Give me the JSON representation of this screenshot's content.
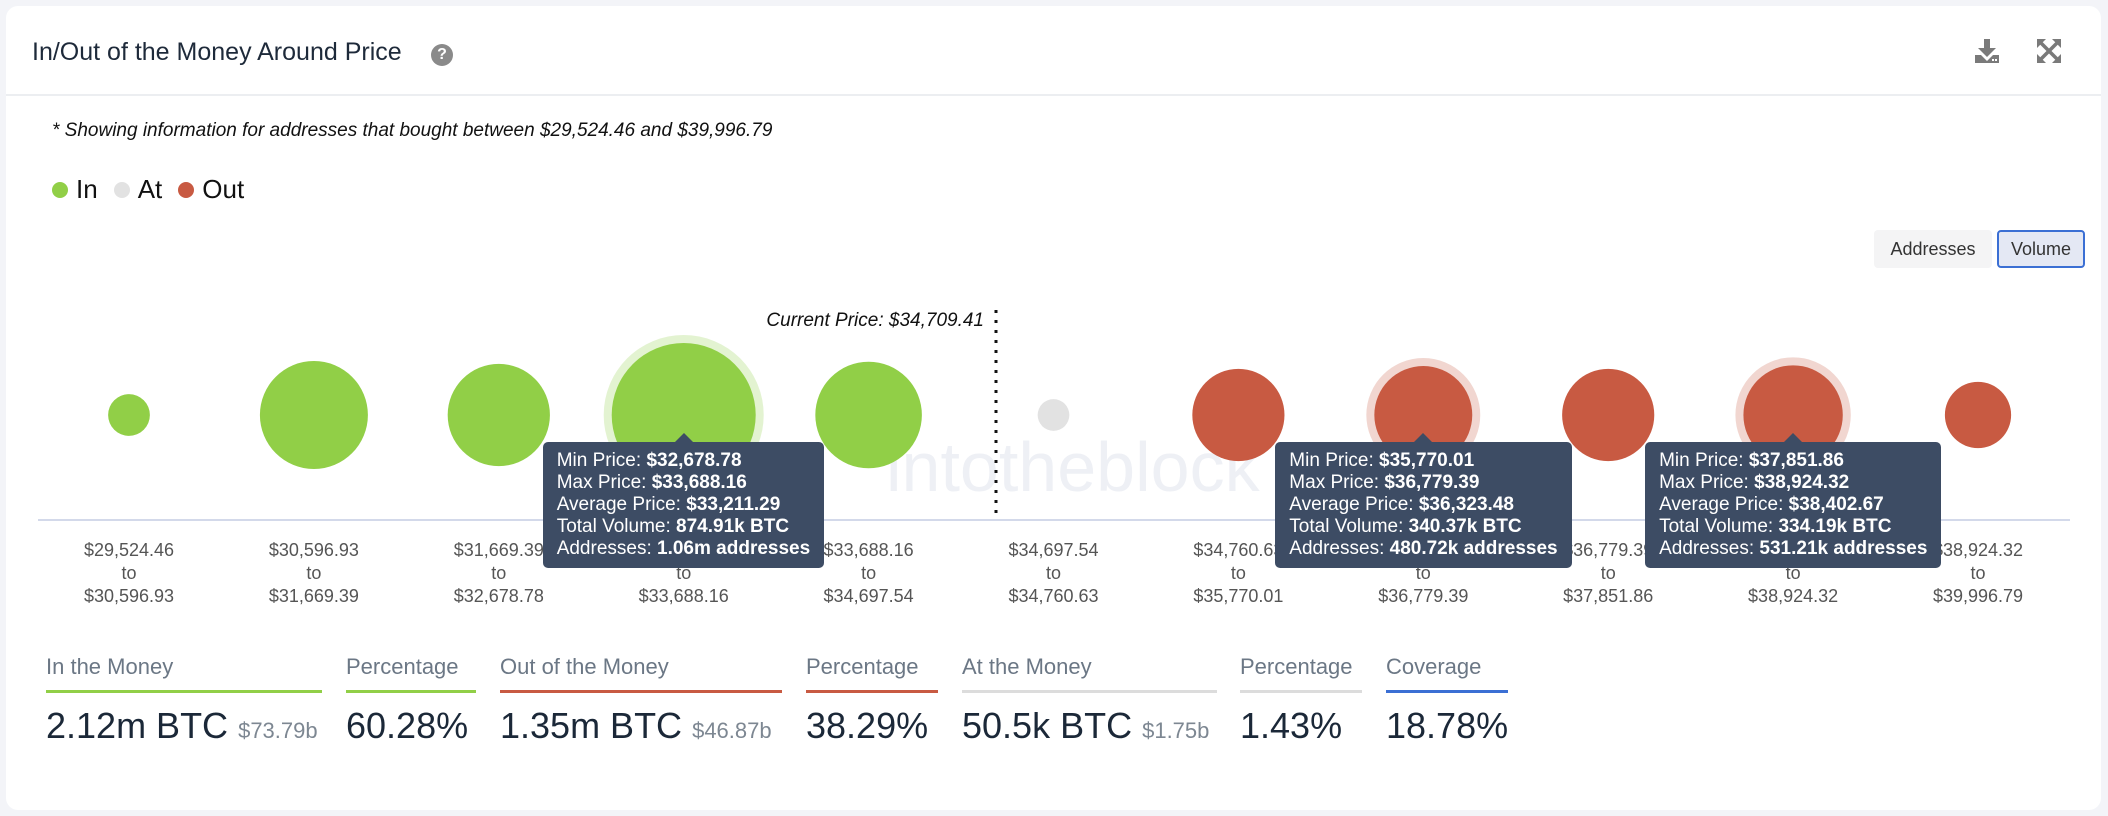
{
  "header": {
    "title": "In/Out of the Money Around Price",
    "help_icon": "question-circle-icon",
    "download_icon": "download-icon",
    "expand_icon": "expand-icon"
  },
  "note": "* Showing information for addresses that bought between $29,524.46 and $39,996.79",
  "legend": [
    {
      "label": "In",
      "color": "#91cf47"
    },
    {
      "label": "At",
      "color": "#e2e2e2"
    },
    {
      "label": "Out",
      "color": "#c85a42"
    }
  ],
  "toggles": {
    "addresses": "Addresses",
    "volume": "Volume",
    "active": "Volume"
  },
  "watermark": "intotheblock",
  "chart_data": {
    "type": "bubble",
    "title": "In/Out of the Money Around Price",
    "current_price_label": "Current Price: $34,709.41",
    "current_price": 34709.41,
    "metric": "Volume",
    "bins": [
      {
        "range": [
          "$29,524.46",
          "$30,596.93"
        ],
        "status": "In",
        "size_rel": 0.29
      },
      {
        "range": [
          "$30,596.93",
          "$31,669.39"
        ],
        "status": "In",
        "size_rel": 0.75
      },
      {
        "range": [
          "$31,669.39",
          "$32,678.78"
        ],
        "status": "In",
        "size_rel": 0.71
      },
      {
        "range": [
          "$32,678.78",
          "$33,688.16"
        ],
        "status": "In",
        "size_rel": 1.0,
        "volume_btc": "874.91k BTC"
      },
      {
        "range": [
          "$33,688.16",
          "$34,697.54"
        ],
        "status": "In",
        "size_rel": 0.74
      },
      {
        "range": [
          "$34,697.54",
          "$34,760.63"
        ],
        "status": "At",
        "size_rel": 0.22
      },
      {
        "range": [
          "$34,760.63",
          "$35,770.01"
        ],
        "status": "Out",
        "size_rel": 0.64
      },
      {
        "range": [
          "$35,770.01",
          "$36,779.39"
        ],
        "status": "Out",
        "size_rel": 0.68,
        "volume_btc": "340.37k BTC"
      },
      {
        "range": [
          "$36,779.39",
          "$37,851.86"
        ],
        "status": "Out",
        "size_rel": 0.64
      },
      {
        "range": [
          "$37,851.86",
          "$38,924.32"
        ],
        "status": "Out",
        "size_rel": 0.69,
        "volume_btc": "334.19k BTC"
      },
      {
        "range": [
          "$38,924.32",
          "$39,996.79"
        ],
        "status": "Out",
        "size_rel": 0.46
      }
    ],
    "tooltips": [
      {
        "bin": 3,
        "lines": [
          [
            "Min Price: ",
            "$32,678.78"
          ],
          [
            "Max Price: ",
            "$33,688.16"
          ],
          [
            "Average Price: ",
            "$33,211.29"
          ],
          [
            "Total Volume: ",
            "874.91k BTC"
          ],
          [
            "Addresses: ",
            "1.06m addresses"
          ]
        ]
      },
      {
        "bin": 7,
        "lines": [
          [
            "Min Price: ",
            "$35,770.01"
          ],
          [
            "Max Price: ",
            "$36,779.39"
          ],
          [
            "Average Price: ",
            "$36,323.48"
          ],
          [
            "Total Volume: ",
            "340.37k BTC"
          ],
          [
            "Addresses: ",
            "480.72k addresses"
          ]
        ]
      },
      {
        "bin": 9,
        "lines": [
          [
            "Min Price: ",
            "$37,851.86"
          ],
          [
            "Max Price: ",
            "$38,924.32"
          ],
          [
            "Average Price: ",
            "$38,402.67"
          ],
          [
            "Total Volume: ",
            "334.19k BTC"
          ],
          [
            "Addresses: ",
            "531.21k addresses"
          ]
        ]
      }
    ],
    "tick_separator": "to",
    "colors": {
      "In": "#91cf47",
      "At": "#e2e2e2",
      "Out": "#c85a42"
    }
  },
  "stats": [
    {
      "label": "In the Money",
      "value": "2.12m BTC",
      "sub": "$73.79b",
      "color": "#91cf47"
    },
    {
      "label": "Percentage",
      "value": "60.28%",
      "sub": "",
      "color": "#91cf47"
    },
    {
      "label": "Out of the Money",
      "value": "1.35m BTC",
      "sub": "$46.87b",
      "color": "#c85a42"
    },
    {
      "label": "Percentage",
      "value": "38.29%",
      "sub": "",
      "color": "#c85a42"
    },
    {
      "label": "At the Money",
      "value": "50.5k BTC",
      "sub": "$1.75b",
      "color": "#dcdcdc"
    },
    {
      "label": "Percentage",
      "value": "1.43%",
      "sub": "",
      "color": "#dcdcdc"
    },
    {
      "label": "Coverage",
      "value": "18.78%",
      "sub": "",
      "color": "#3b6fd4"
    }
  ]
}
